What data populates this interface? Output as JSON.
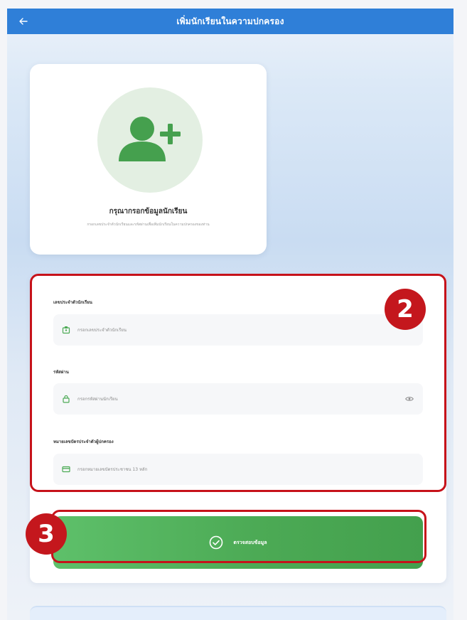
{
  "appbar": {
    "title": "เพิ่มนักเรียนในความปกครอง"
  },
  "profile_card": {
    "heading": "กรุณากรอกข้อมูลนักเรียน",
    "subtitle": "กรอกเลขประจำตัวนักเรียนและรหัสผ่านเพื่อเพิ่มนักเรียนในความปกครองของท่าน"
  },
  "form": {
    "fields": [
      {
        "label": "เลขประจำตัวนักเรียน",
        "placeholder": "กรอกเลขประจำตัวนักเรียน",
        "icon": "badge-icon"
      },
      {
        "label": "รหัสผ่าน",
        "placeholder": "กรอกรหัสผ่านนักเรียน",
        "icon": "lock-icon"
      },
      {
        "label": "หมายเลขบัตรประจำตัวผู้ปกครอง",
        "placeholder": "กรอกหมายเลขบัตรประชาชน 13 หลัก",
        "icon": "id-card-icon"
      }
    ],
    "submit_label": "ตรวจสอบข้อมูล"
  },
  "annotations": {
    "badge_2": "2",
    "badge_3": "3"
  },
  "colors": {
    "appbar": "#2f7fd8",
    "accent_green": "#4caa55",
    "annotation_red": "#c4171d"
  }
}
